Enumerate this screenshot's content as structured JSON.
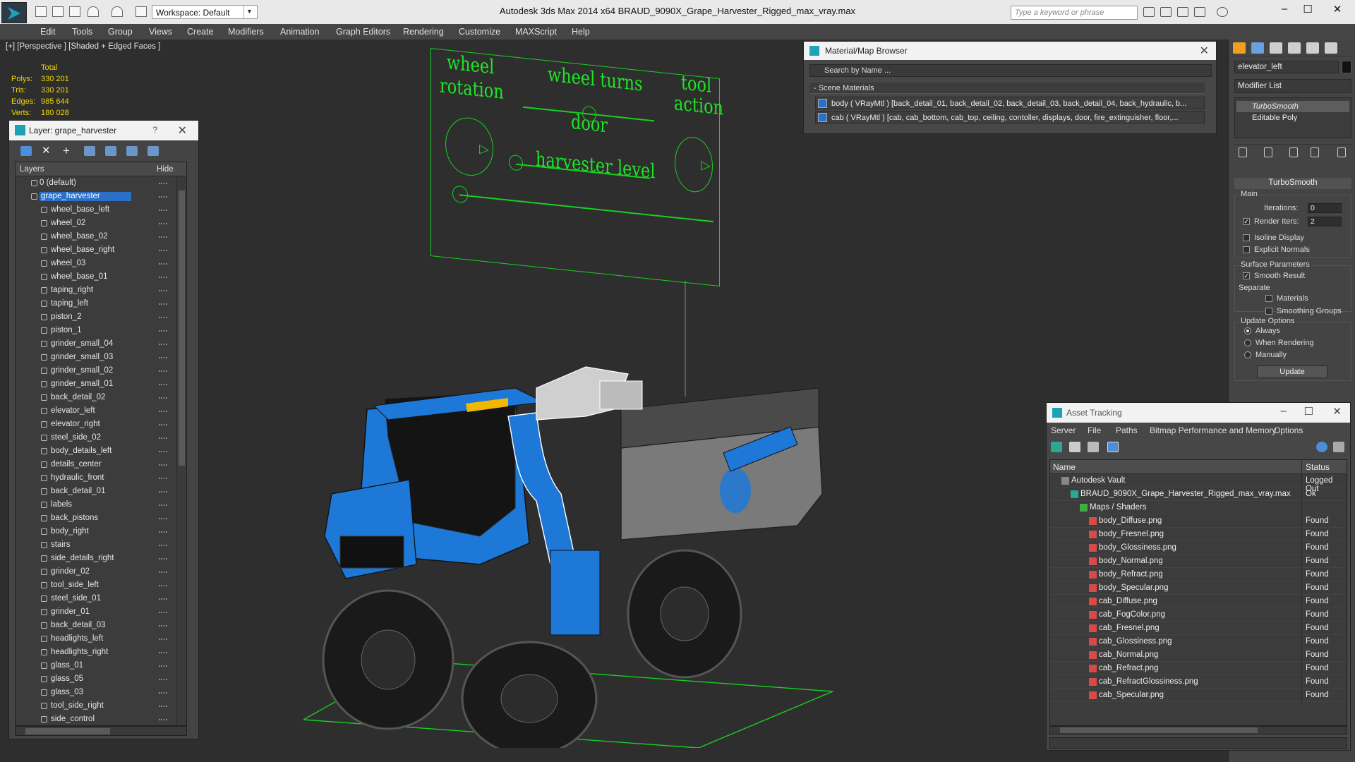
{
  "titlebar": {
    "workspace": "Workspace: Default",
    "title": "Autodesk 3ds Max  2014 x64      BRAUD_9090X_Grape_Harvester_Rigged_max_vray.max",
    "search_placeholder": "Type a keyword or phrase"
  },
  "menu": [
    "Edit",
    "Tools",
    "Group",
    "Views",
    "Create",
    "Modifiers",
    "Animation",
    "Graph Editors",
    "Rendering",
    "Customize",
    "MAXScript",
    "Help"
  ],
  "viewport": {
    "label": "[+] [Perspective ] [Shaded + Edged Faces ]",
    "stats": {
      "header": "Total",
      "rows": [
        {
          "k": "Polys:",
          "v": "330 201"
        },
        {
          "k": "Tris:",
          "v": "330 201"
        },
        {
          "k": "Edges:",
          "v": "985 644"
        },
        {
          "k": "Verts:",
          "v": "180 028"
        }
      ]
    },
    "controls": {
      "wheel_rotation_1": "wheel",
      "wheel_rotation_2": "rotation",
      "wheel_turns": "wheel turns",
      "tool_action_1": "tool",
      "tool_action_2": "action",
      "door": "door",
      "harvester_level": "harvester level"
    }
  },
  "layer_panel": {
    "title": "Layer: grape_harvester",
    "help": "?",
    "col_layers": "Layers",
    "col_hide": "Hide",
    "default_layer": "0 (default)",
    "selected_layer": "grape_harvester",
    "items": [
      "wheel_base_left",
      "wheel_02",
      "wheel_base_02",
      "wheel_base_right",
      "wheel_03",
      "wheel_base_01",
      "taping_right",
      "taping_left",
      "piston_2",
      "piston_1",
      "grinder_small_04",
      "grinder_small_03",
      "grinder_small_02",
      "grinder_small_01",
      "back_detail_02",
      "elevator_left",
      "elevator_right",
      "steel_side_02",
      "body_details_left",
      "details_center",
      "hydraulic_front",
      "back_detail_01",
      "labels",
      "back_pistons",
      "body_right",
      "stairs",
      "side_details_right",
      "grinder_02",
      "tool_side_left",
      "steel_side_01",
      "grinder_01",
      "back_detail_03",
      "headlights_left",
      "headlights_right",
      "glass_01",
      "glass_05",
      "glass_03",
      "tool_side_right",
      "side_control"
    ]
  },
  "material_browser": {
    "title": "Material/Map Browser",
    "search_placeholder": "Search by Name ...",
    "section": "- Scene Materials",
    "rows": [
      "body  ( VRayMtl ) [back_detail_01, back_detail_02, back_detail_03, back_detail_04, back_hydraulic, b...",
      "cab  ( VRayMtl ) [cab, cab_bottom, cab_top, ceiling, contoller, displays, door, fire_extinguisher, floor,..."
    ]
  },
  "command_panel": {
    "object_name": "elevator_left",
    "modifier_list": "Modifier List",
    "stack": [
      "TurboSmooth",
      "Editable Poly"
    ],
    "rollout": "TurboSmooth",
    "main_group": "Main",
    "iterations_label": "Iterations:",
    "iterations": "0",
    "render_iters_label": "Render Iters:",
    "render_iters": "2",
    "isoline": "Isoline Display",
    "explicit_normals": "Explicit Normals",
    "surface_group": "Surface Parameters",
    "smooth_result": "Smooth Result",
    "separate": "Separate",
    "materials": "Materials",
    "smoothing_groups": "Smoothing Groups",
    "update_group": "Update Options",
    "always": "Always",
    "when_rendering": "When Rendering",
    "manually": "Manually",
    "update_btn": "Update"
  },
  "asset_tracking": {
    "title": "Asset Tracking",
    "menu": [
      "Server",
      "File",
      "Paths",
      "Bitmap Performance and Memory",
      "Options"
    ],
    "col_name": "Name",
    "col_status": "Status",
    "rows": [
      {
        "name": "Autodesk Vault",
        "status": "Logged Out",
        "level": 0,
        "icon": "vault-icon"
      },
      {
        "name": "BRAUD_9090X_Grape_Harvester_Rigged_max_vray.max",
        "status": "Ok",
        "level": 1,
        "icon": "max-file-icon"
      },
      {
        "name": "Maps / Shaders",
        "status": "",
        "level": 2,
        "icon": "maps-folder-icon"
      },
      {
        "name": "body_Diffuse.png",
        "status": "Found",
        "level": 3,
        "icon": "png-icon"
      },
      {
        "name": "body_Fresnel.png",
        "status": "Found",
        "level": 3,
        "icon": "png-icon"
      },
      {
        "name": "body_Glossiness.png",
        "status": "Found",
        "level": 3,
        "icon": "png-icon"
      },
      {
        "name": "body_Normal.png",
        "status": "Found",
        "level": 3,
        "icon": "png-icon"
      },
      {
        "name": "body_Refract.png",
        "status": "Found",
        "level": 3,
        "icon": "png-icon"
      },
      {
        "name": "body_Specular.png",
        "status": "Found",
        "level": 3,
        "icon": "png-icon"
      },
      {
        "name": "cab_Diffuse.png",
        "status": "Found",
        "level": 3,
        "icon": "png-icon"
      },
      {
        "name": "cab_FogColor.png",
        "status": "Found",
        "level": 3,
        "icon": "png-icon"
      },
      {
        "name": "cab_Fresnel.png",
        "status": "Found",
        "level": 3,
        "icon": "png-icon"
      },
      {
        "name": "cab_Glossiness.png",
        "status": "Found",
        "level": 3,
        "icon": "png-icon"
      },
      {
        "name": "cab_Normal.png",
        "status": "Found",
        "level": 3,
        "icon": "png-icon"
      },
      {
        "name": "cab_Refract.png",
        "status": "Found",
        "level": 3,
        "icon": "png-icon"
      },
      {
        "name": "cab_RefractGlossiness.png",
        "status": "Found",
        "level": 3,
        "icon": "png-icon"
      },
      {
        "name": "cab_Specular.png",
        "status": "Found",
        "level": 3,
        "icon": "png-icon"
      }
    ]
  },
  "colors": {
    "accent_teal": "#1ea2b8",
    "selection_blue": "#2a6fc8",
    "stats_yellow": "#f0d800",
    "gizmo_green": "#17d11f",
    "machine_blue": "#1e78d8"
  }
}
